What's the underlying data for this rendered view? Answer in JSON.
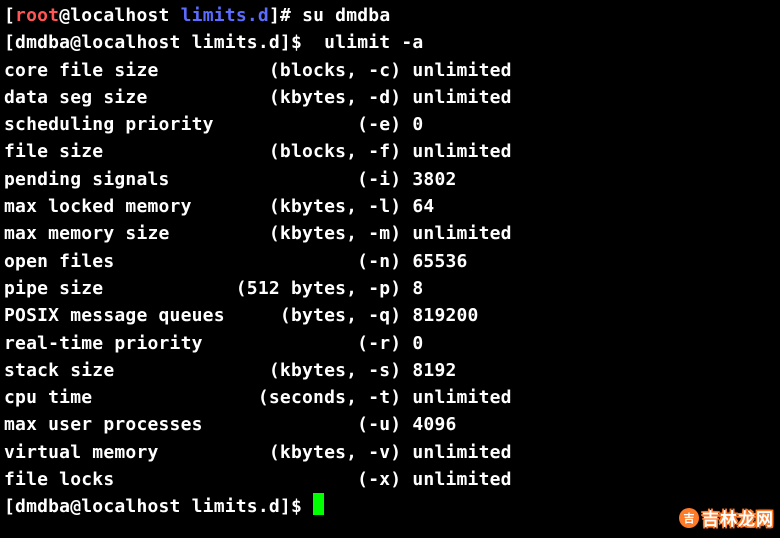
{
  "prompt_root": {
    "lb": "[",
    "user": "root",
    "at": "@",
    "host": "localhost",
    "sp": " ",
    "dir": "limits.d",
    "rb": "]",
    "sym": "#",
    "cmd": " su dmdba"
  },
  "prompt_dmdba1": {
    "text": "[dmdba@localhost limits.d]$ ",
    "cmd": " ulimit -a"
  },
  "prompt_dmdba2": {
    "text": "[dmdba@localhost limits.d]$ "
  },
  "ulimit": [
    {
      "label": "core file size          (blocks, -c) ",
      "value": "unlimited"
    },
    {
      "label": "data seg size           (kbytes, -d) ",
      "value": "unlimited"
    },
    {
      "label": "scheduling priority             (-e) ",
      "value": "0"
    },
    {
      "label": "file size               (blocks, -f) ",
      "value": "unlimited"
    },
    {
      "label": "pending signals                 (-i) ",
      "value": "3802"
    },
    {
      "label": "max locked memory       (kbytes, -l) ",
      "value": "64"
    },
    {
      "label": "max memory size         (kbytes, -m) ",
      "value": "unlimited"
    },
    {
      "label": "open files                      (-n) ",
      "value": "65536"
    },
    {
      "label": "pipe size            (512 bytes, -p) ",
      "value": "8"
    },
    {
      "label": "POSIX message queues     (bytes, -q) ",
      "value": "819200"
    },
    {
      "label": "real-time priority              (-r) ",
      "value": "0"
    },
    {
      "label": "stack size              (kbytes, -s) ",
      "value": "8192"
    },
    {
      "label": "cpu time               (seconds, -t) ",
      "value": "unlimited"
    },
    {
      "label": "max user processes              (-u) ",
      "value": "4096"
    },
    {
      "label": "virtual memory          (kbytes, -v) ",
      "value": "unlimited"
    },
    {
      "label": "file locks                      (-x) ",
      "value": "unlimited"
    }
  ],
  "watermark": {
    "dot": "吉",
    "text": "吉林龙网"
  }
}
